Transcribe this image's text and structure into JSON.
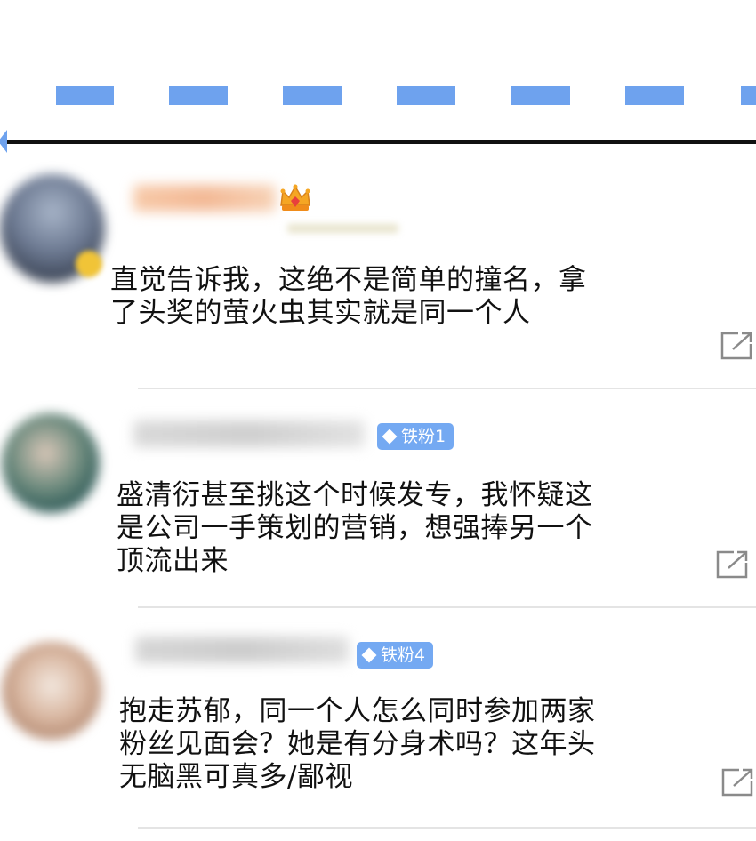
{
  "colors": {
    "accent": "#6ea2ee",
    "badge": "#74a9f2",
    "text": "#111111",
    "divider": "#e4e4e4"
  },
  "comments": [
    {
      "user_name": "",
      "badge_type": "crown-icon",
      "text_lines": [
        "直觉告诉我，这绝不是简单的撞名，拿",
        "了头奖的萤火虫其实就是同一个人"
      ]
    },
    {
      "user_name": "",
      "badge_label": "铁粉1",
      "text_lines": [
        "盛清衍甚至挑这个时候发专，我怀疑这",
        "是公司一手策划的营销，想强捧另一个",
        "顶流出来"
      ]
    },
    {
      "user_name": "",
      "badge_label": "铁粉4",
      "text_lines": [
        "抱走苏郁，同一个人怎么同时参加两家",
        "粉丝见面会？她是有分身术吗？这年头",
        "无脑黑可真多/鄙视"
      ]
    }
  ],
  "icons": {
    "share": "share-icon",
    "fan_badge": "diamond-icon"
  }
}
